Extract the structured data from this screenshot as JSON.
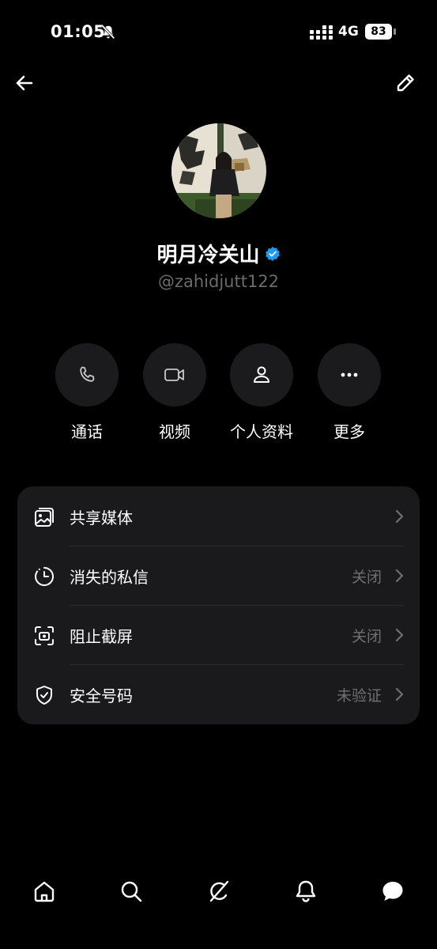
{
  "status_bar": {
    "time": "01:05",
    "network": "4G",
    "battery": "83"
  },
  "profile": {
    "name": "明月冷关山",
    "handle": "@zahidjutt122",
    "verified": true
  },
  "actions": [
    {
      "label": "通话",
      "icon": "phone-icon"
    },
    {
      "label": "视频",
      "icon": "video-icon"
    },
    {
      "label": "个人资料",
      "icon": "person-icon"
    },
    {
      "label": "更多",
      "icon": "more-icon"
    }
  ],
  "settings": [
    {
      "label": "共享媒体",
      "value": "",
      "icon": "gallery-icon"
    },
    {
      "label": "消失的私信",
      "value": "关闭",
      "icon": "timer-icon"
    },
    {
      "label": "阻止截屏",
      "value": "关闭",
      "icon": "screenshot-icon"
    },
    {
      "label": "安全号码",
      "value": "未验证",
      "icon": "shield-icon"
    }
  ],
  "tabs": [
    "home-icon",
    "search-icon",
    "grok-icon",
    "bell-icon",
    "messages-icon"
  ],
  "colors": {
    "background": "#000000",
    "card": "#1a1a1d",
    "button": "#1b1b1e",
    "verified": "#1d9bf0",
    "muted_text": "#6b6b6b"
  }
}
